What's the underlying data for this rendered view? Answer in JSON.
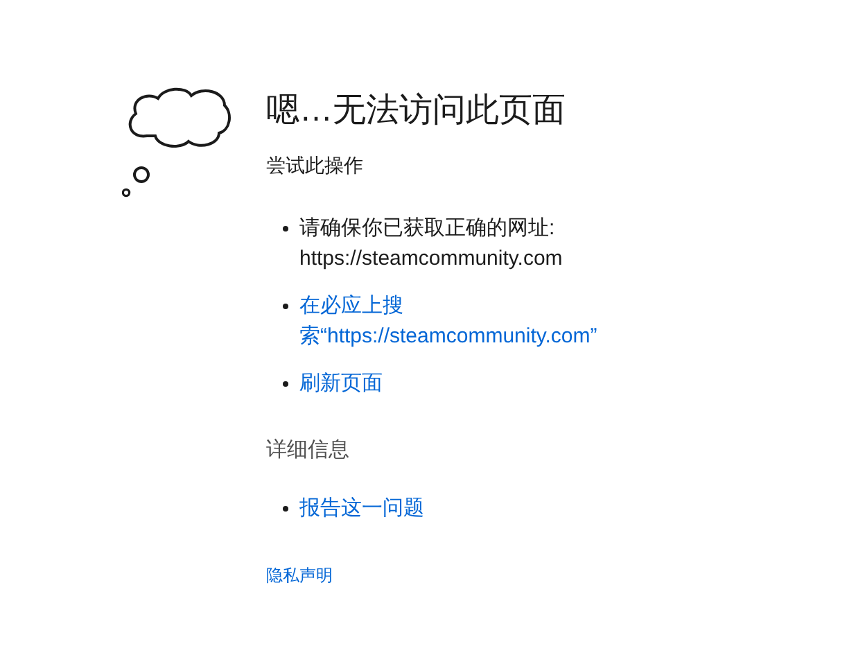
{
  "title": "嗯…无法访问此页面",
  "subtitle": "尝试此操作",
  "suggestions": [
    {
      "kind": "text",
      "text": "请确保你已获取正确的网址: https://steamcommunity.com"
    },
    {
      "kind": "link",
      "text": "在必应上搜索“https://steamcommunity.com”"
    },
    {
      "kind": "link",
      "text": "刷新页面"
    }
  ],
  "details_heading": "详细信息",
  "details_items": [
    {
      "kind": "link",
      "text": "报告这一问题"
    }
  ],
  "privacy_link": "隐私声明"
}
